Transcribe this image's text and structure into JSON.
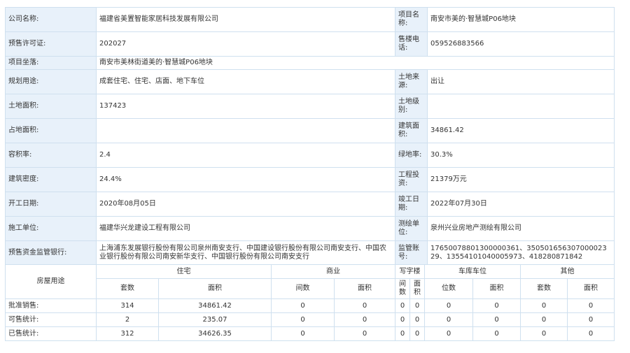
{
  "info": {
    "company_label": "公司名称:",
    "company_value": "福建省美置智能家居科技发展有限公司",
    "project_label": "项目名称:",
    "project_value": "南安市美的·智慧城P06地块",
    "permit_label": "预售许可证:",
    "permit_value": "202027",
    "phone_label": "售楼电话:",
    "phone_value": "059526883566",
    "location_label": "项目坐落:",
    "location_value": "南安市美林街道美的·智慧城P06地块",
    "usage_label": "规划用途:",
    "usage_value": "成套住宅、住宅、店面、地下车位",
    "land_source_label": "土地来源:",
    "land_source_value": "出让",
    "land_area_label": "土地面积:",
    "land_area_value": "137423",
    "land_grade_label": "土地级别:",
    "land_grade_value": "",
    "occupied_label": "占地面积:",
    "occupied_value": "",
    "building_area_label": "建筑面积:",
    "building_area_value": "34861.42",
    "far_label": "容积率:",
    "far_value": "2.4",
    "green_label": "绿地率:",
    "green_value": "30.3%",
    "density_label": "建筑密度:",
    "density_value": "24.4%",
    "investment_label": "工程投资:",
    "investment_value": "21379万元",
    "start_label": "开工日期:",
    "start_value": "2020年08月05日",
    "finish_label": "竣工日期:",
    "finish_value": "2022年07月30日",
    "builder_label": "施工单位:",
    "builder_value": "福建华兴龙建设工程有限公司",
    "surveyor_label": "测绘单位:",
    "surveyor_value": "泉州兴业房地产测绘有限公司",
    "bank_label": "预售资金监管银行:",
    "bank_value": "上海浦东发展银行股份有限公司泉州南安支行、中国建设银行股份有限公司南安支行、中国农业银行股份有限公司南安新华支行、中国银行股份有限公司南安支行",
    "account_label": "监管账号:",
    "account_value": "17650078801300000361、35050165630700002329、13554101040005973、418280871842"
  },
  "stats": {
    "house_use_label": "房屋用途",
    "groups": [
      "住宅",
      "商业",
      "写字楼",
      "车库车位",
      "其他"
    ],
    "sub_residential": [
      "套数",
      "面积"
    ],
    "sub_commercial": [
      "间数",
      "面积"
    ],
    "sub_office": [
      "间数",
      "面积"
    ],
    "sub_parking": [
      "位数",
      "面积"
    ],
    "sub_other": [
      "套数",
      "面积"
    ],
    "rows": [
      {
        "label": "批准销售:",
        "cells": [
          "314",
          "34861.42",
          "0",
          "0",
          "0",
          "0",
          "0",
          "0",
          "0",
          "0"
        ]
      },
      {
        "label": "可售统计:",
        "cells": [
          "2",
          "235.07",
          "0",
          "0",
          "0",
          "0",
          "0",
          "0",
          "0",
          "0"
        ]
      },
      {
        "label": "已售统计:",
        "cells": [
          "312",
          "34626.35",
          "0",
          "0",
          "0",
          "0",
          "0",
          "0",
          "0",
          "0"
        ]
      }
    ]
  }
}
